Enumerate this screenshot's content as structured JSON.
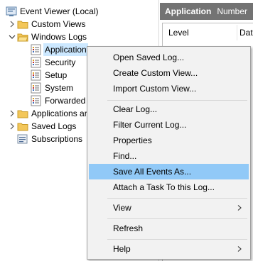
{
  "tree": {
    "items": [
      {
        "label": "Event Viewer (Local)"
      },
      {
        "label": "Custom Views"
      },
      {
        "label": "Windows Logs"
      },
      {
        "label": "Application"
      },
      {
        "label": "Security"
      },
      {
        "label": "Setup"
      },
      {
        "label": "System"
      },
      {
        "label": "Forwarded"
      },
      {
        "label": "Applications ar"
      },
      {
        "label": "Saved Logs"
      },
      {
        "label": "Subscriptions"
      }
    ]
  },
  "right_pane": {
    "title": "Application",
    "number_label": "Number",
    "columns": [
      "Level",
      "Date"
    ]
  },
  "context_menu": {
    "items": [
      {
        "label": "Open Saved Log..."
      },
      {
        "label": "Create Custom View..."
      },
      {
        "label": "Import Custom View..."
      },
      {
        "label": "Clear Log..."
      },
      {
        "label": "Filter Current Log..."
      },
      {
        "label": "Properties"
      },
      {
        "label": "Find..."
      },
      {
        "label": "Save All Events As..."
      },
      {
        "label": "Attach a Task To this Log..."
      },
      {
        "label": "View"
      },
      {
        "label": "Refresh"
      },
      {
        "label": "Help"
      }
    ],
    "highlighted": "Save All Events As..."
  },
  "colors": {
    "selection": "#cce8ff",
    "menu_highlight": "#91c9f7",
    "header_bg": "#737373"
  }
}
